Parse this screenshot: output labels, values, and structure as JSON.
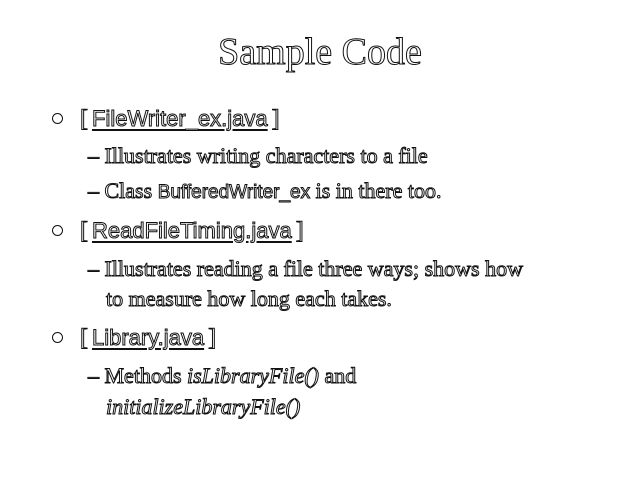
{
  "slide": {
    "title": "Sample Code",
    "items": [
      {
        "open_bracket": "[",
        "file": "FileWriter_ex.java",
        "close_bracket": "]",
        "details": {
          "line1": "– Illustrates writing characters to a file",
          "line2_prefix": "– Class ",
          "line2_code": "BufferedWriter_ex",
          "line2_suffix": " is in there too."
        }
      },
      {
        "open_bracket": "[",
        "file": "ReadFileTiming.java",
        "close_bracket": "]",
        "details": {
          "line1": "– Illustrates reading a file three ways; shows how",
          "line1_cont": "to measure how long each takes."
        }
      },
      {
        "open_bracket": "[",
        "file": "Library.java",
        "close_bracket": "]",
        "details": {
          "line1_prefix": "– Methods ",
          "method1": "isLibraryFile()",
          "line1_mid": " and",
          "method2": "initializeLibraryFile()"
        }
      }
    ]
  }
}
